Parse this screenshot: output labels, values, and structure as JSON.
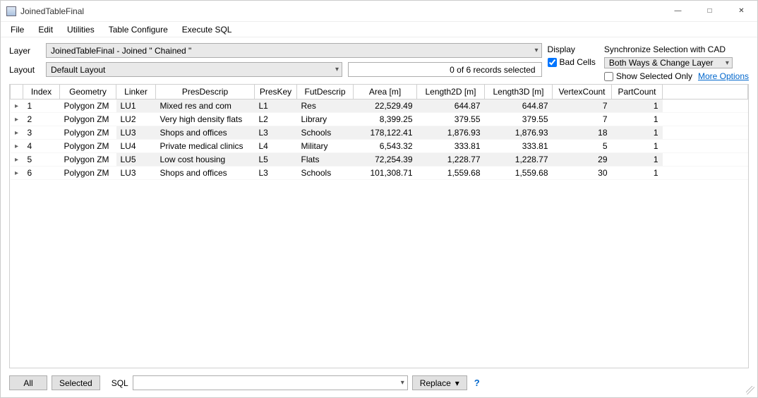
{
  "window": {
    "title": "JoinedTableFinal"
  },
  "menu": {
    "file": "File",
    "edit": "Edit",
    "utilities": "Utilities",
    "table_configure": "Table Configure",
    "execute_sql": "Execute SQL"
  },
  "controls": {
    "layer_label": "Layer",
    "layer_value": "JoinedTableFinal - Joined \" Chained \"",
    "layout_label": "Layout",
    "layout_value": "Default Layout",
    "status": "0 of 6 records selected"
  },
  "display": {
    "title": "Display",
    "bad_cells_label": "Bad Cells",
    "bad_cells_checked": true
  },
  "sync": {
    "title": "Synchronize Selection with CAD",
    "combo_value": "Both Ways & Change Layer",
    "show_selected_label": "Show Selected Only",
    "show_selected_checked": false,
    "more_options": "More Options"
  },
  "table": {
    "headers": {
      "index": "Index",
      "geometry": "Geometry",
      "linker": "Linker",
      "presdescrip": "PresDescrip",
      "preskey": "PresKey",
      "futdescrip": "FutDescrip",
      "area": "Area [m]",
      "length2d": "Length2D [m]",
      "length3d": "Length3D [m]",
      "vertexcount": "VertexCount",
      "partcount": "PartCount"
    },
    "rows": [
      {
        "index": "1",
        "geometry": "Polygon ZM",
        "linker": "LU1",
        "presdescrip": "Mixed res and com",
        "preskey": "L1",
        "futdescrip": "Res",
        "area": "22,529.49",
        "length2d": "644.87",
        "length3d": "644.87",
        "vertexcount": "7",
        "partcount": "1"
      },
      {
        "index": "2",
        "geometry": "Polygon ZM",
        "linker": "LU2",
        "presdescrip": "Very high density flats",
        "preskey": "L2",
        "futdescrip": "Library",
        "area": "8,399.25",
        "length2d": "379.55",
        "length3d": "379.55",
        "vertexcount": "7",
        "partcount": "1"
      },
      {
        "index": "3",
        "geometry": "Polygon ZM",
        "linker": "LU3",
        "presdescrip": "Shops and offices",
        "preskey": "L3",
        "futdescrip": "Schools",
        "area": "178,122.41",
        "length2d": "1,876.93",
        "length3d": "1,876.93",
        "vertexcount": "18",
        "partcount": "1"
      },
      {
        "index": "4",
        "geometry": "Polygon ZM",
        "linker": "LU4",
        "presdescrip": "Private medical clinics",
        "preskey": "L4",
        "futdescrip": "Military",
        "area": "6,543.32",
        "length2d": "333.81",
        "length3d": "333.81",
        "vertexcount": "5",
        "partcount": "1"
      },
      {
        "index": "5",
        "geometry": "Polygon ZM",
        "linker": "LU5",
        "presdescrip": "Low cost housing",
        "preskey": "L5",
        "futdescrip": "Flats",
        "area": "72,254.39",
        "length2d": "1,228.77",
        "length3d": "1,228.77",
        "vertexcount": "29",
        "partcount": "1"
      },
      {
        "index": "6",
        "geometry": "Polygon ZM",
        "linker": "LU3",
        "presdescrip": "Shops and offices",
        "preskey": "L3",
        "futdescrip": "Schools",
        "area": "101,308.71",
        "length2d": "1,559.68",
        "length3d": "1,559.68",
        "vertexcount": "30",
        "partcount": "1"
      }
    ]
  },
  "bottom": {
    "all": "All",
    "selected": "Selected",
    "sql_label": "SQL",
    "sql_value": "",
    "replace": "Replace",
    "help": "?"
  }
}
